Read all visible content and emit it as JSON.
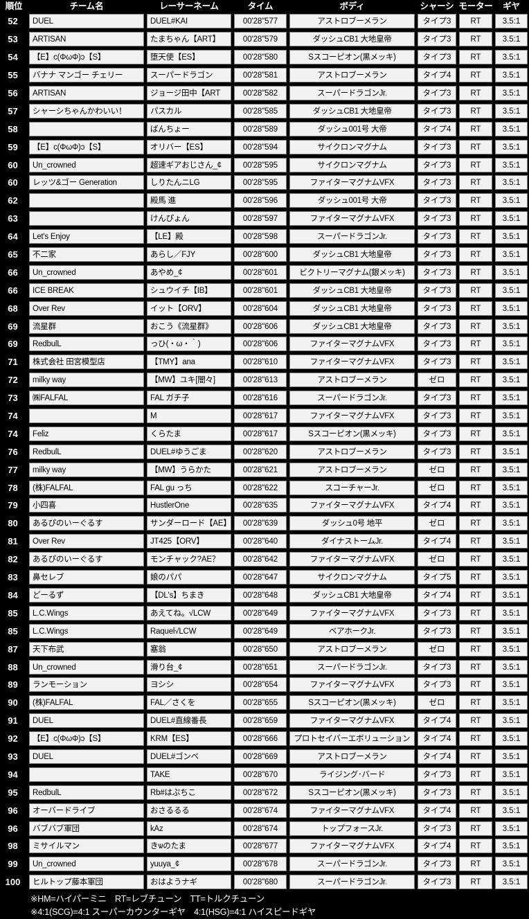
{
  "table": {
    "headers": [
      "順位",
      "チーム名",
      "レーサーネーム",
      "タイム",
      "ボディ",
      "シャーシ",
      "モーター",
      "ギヤ"
    ],
    "rows": [
      {
        "rank": "52",
        "team": "DUEL",
        "racer": "DUEL#KAI",
        "time": "00'28\"577",
        "body": "アストロブーメラン",
        "chassis": "タイプ3",
        "motor": "RT",
        "gear": "3.5:1"
      },
      {
        "rank": "53",
        "team": "ARTISAN",
        "racer": "たまちゃん【ART】",
        "time": "00'28\"579",
        "body": "ダッシュCB1 大地皇帝",
        "chassis": "タイプ3",
        "motor": "RT",
        "gear": "3.5:1"
      },
      {
        "rank": "54",
        "team": "【E】ϲ(ΦωΦ)ɔ【S】",
        "racer": "堕天使【ES】",
        "time": "00'28\"580",
        "body": "Sスコーピオン(黒メッキ)",
        "chassis": "タイプ3",
        "motor": "RT",
        "gear": "3.5:1"
      },
      {
        "rank": "55",
        "team": "バナナ マンゴー チェリー",
        "racer": "スーパードラゴン",
        "time": "00'28\"581",
        "body": "アストロブーメラン",
        "chassis": "タイプ4",
        "motor": "RT",
        "gear": "3.5:1"
      },
      {
        "rank": "56",
        "team": "ARTISAN",
        "racer": "ジョージ田中【ART",
        "time": "00'28\"582",
        "body": "スーパードラゴンJr.",
        "chassis": "タイプ3",
        "motor": "RT",
        "gear": "3.5:1"
      },
      {
        "rank": "57",
        "team": "シャーシちゃんかわいい！",
        "racer": "パスカル",
        "time": "00'28\"585",
        "body": "ダッシュCB1 大地皇帝",
        "chassis": "タイプ3",
        "motor": "RT",
        "gear": "3.5:1"
      },
      {
        "rank": "58",
        "team": "",
        "racer": "ばんちょー",
        "time": "00'28\"589",
        "body": "ダッシュ001号 大帝",
        "chassis": "タイプ4",
        "motor": "RT",
        "gear": "3.5:1"
      },
      {
        "rank": "59",
        "team": "【E】ϲ(ΦωΦ)ɔ【S】",
        "racer": "オリバー【ES】",
        "time": "00'28\"594",
        "body": "サイクロンマグナム",
        "chassis": "タイプ3",
        "motor": "RT",
        "gear": "3.5:1"
      },
      {
        "rank": "60",
        "team": "Un_crowned",
        "racer": "超速ギアおじさん_¢",
        "time": "00'28\"595",
        "body": "サイクロンマグナム",
        "chassis": "タイプ3",
        "motor": "RT",
        "gear": "3.5:1"
      },
      {
        "rank": "60",
        "team": "レッツ&ゴー Generation",
        "racer": "しりたんニLG",
        "time": "00'28\"595",
        "body": "ファイターマグナムVFX",
        "chassis": "タイプ3",
        "motor": "RT",
        "gear": "3.5:1"
      },
      {
        "rank": "62",
        "team": "",
        "racer": "殿馬 進",
        "time": "00'28\"596",
        "body": "ダッシュ001号 大帝",
        "chassis": "タイプ3",
        "motor": "RT",
        "gear": "3.5:1"
      },
      {
        "rank": "63",
        "team": "",
        "racer": "けんぴょん",
        "time": "00'28\"597",
        "body": "ファイターマグナムVFX",
        "chassis": "タイプ3",
        "motor": "RT",
        "gear": "3.5:1"
      },
      {
        "rank": "64",
        "team": "Let's Enjoy",
        "racer": "【LE】殿",
        "time": "00'28\"598",
        "body": "スーパードラゴンJr.",
        "chassis": "タイプ3",
        "motor": "RT",
        "gear": "3.5:1"
      },
      {
        "rank": "65",
        "team": "不二家",
        "racer": "あらし／FJY",
        "time": "00'28\"600",
        "body": "ダッシュCB1 大地皇帝",
        "chassis": "タイプ3",
        "motor": "RT",
        "gear": "3.5:1"
      },
      {
        "rank": "66",
        "team": "Un_crowned",
        "racer": "あやめ_¢",
        "time": "00'28\"601",
        "body": "ビクトリーマグナム(銀メッキ)",
        "chassis": "タイプ3",
        "motor": "RT",
        "gear": "3.5:1"
      },
      {
        "rank": "66",
        "team": "ICE BREAK",
        "racer": "シュウイチ【IB】",
        "time": "00'28\"601",
        "body": "ダッシュCB1 大地皇帝",
        "chassis": "タイプ3",
        "motor": "RT",
        "gear": "3.5:1"
      },
      {
        "rank": "68",
        "team": "Over Rev",
        "racer": "イット【ORV】",
        "time": "00'28\"604",
        "body": "ダッシュCB1 大地皇帝",
        "chassis": "タイプ3",
        "motor": "RT",
        "gear": "3.5:1"
      },
      {
        "rank": "69",
        "team": "流星群",
        "racer": "おこう《流星群》",
        "time": "00'28\"606",
        "body": "ダッシュCB1 大地皇帝",
        "chassis": "タイプ3",
        "motor": "RT",
        "gear": "3.5:1"
      },
      {
        "rank": "69",
        "team": "RedbulL",
        "racer": "っひ(・ω・｀)",
        "time": "00'28\"606",
        "body": "ファイターマグナムVFX",
        "chassis": "タイプ3",
        "motor": "RT",
        "gear": "3.5:1"
      },
      {
        "rank": "71",
        "team": "株式会社 田宮模型店",
        "racer": "【TMY】ana",
        "time": "00'28\"610",
        "body": "ファイターマグナムVFX",
        "chassis": "タイプ3",
        "motor": "RT",
        "gear": "3.5:1"
      },
      {
        "rank": "72",
        "team": "milky way",
        "racer": "【MW】ユキ[闇々]",
        "time": "00'28\"613",
        "body": "アストロブーメラン",
        "chassis": "ゼロ",
        "motor": "RT",
        "gear": "3.5:1"
      },
      {
        "rank": "73",
        "team": "㈱FALFAL",
        "racer": "FAL ガチ子",
        "time": "00'28\"616",
        "body": "スーパードラゴンJr.",
        "chassis": "タイプ3",
        "motor": "RT",
        "gear": "3.5:1"
      },
      {
        "rank": "74",
        "team": "",
        "racer": "M",
        "time": "00'28\"617",
        "body": "ファイターマグナムVFX",
        "chassis": "タイプ3",
        "motor": "RT",
        "gear": "3.5:1"
      },
      {
        "rank": "74",
        "team": "Feliz",
        "racer": "くらたま",
        "time": "00'28\"617",
        "body": "Sスコーピオン(黒メッキ)",
        "chassis": "タイプ3",
        "motor": "RT",
        "gear": "3.5:1"
      },
      {
        "rank": "76",
        "team": "RedbulL",
        "racer": "DUEL#ゆうごま",
        "time": "00'28\"620",
        "body": "アストロブーメラン",
        "chassis": "タイプ3",
        "motor": "RT",
        "gear": "3.5:1"
      },
      {
        "rank": "77",
        "team": "milky way",
        "racer": "【MW】うらかた",
        "time": "00'28\"621",
        "body": "アストロブーメラン",
        "chassis": "ゼロ",
        "motor": "RT",
        "gear": "3.5:1"
      },
      {
        "rank": "78",
        "team": "(株)FALFAL",
        "racer": "FAL gu っち",
        "time": "00'28\"622",
        "body": "スコーチャーJr.",
        "chassis": "ゼロ",
        "motor": "RT",
        "gear": "3.5:1"
      },
      {
        "rank": "79",
        "team": "小四喜",
        "racer": "HustlerOne",
        "time": "00'28\"635",
        "body": "ファイターマグナムVFX",
        "chassis": "タイプ4",
        "motor": "RT",
        "gear": "3.5:1"
      },
      {
        "rank": "80",
        "team": "あるぴのいーぐるす",
        "racer": "サンダーロード【AE】",
        "time": "00'28\"639",
        "body": "ダッシュ0号 地平",
        "chassis": "ゼロ",
        "motor": "RT",
        "gear": "3.5:1"
      },
      {
        "rank": "81",
        "team": "Over Rev",
        "racer": "JT425【ORV】",
        "time": "00'28\"640",
        "body": "ダイナストームJr.",
        "chassis": "タイプ4",
        "motor": "RT",
        "gear": "3.5:1"
      },
      {
        "rank": "82",
        "team": "あるぴのいーぐるす",
        "racer": "モンチャック?AE？",
        "time": "00'28\"642",
        "body": "ファイターマグナムVFX",
        "chassis": "ゼロ",
        "motor": "RT",
        "gear": "3.5:1"
      },
      {
        "rank": "83",
        "team": "鼻セレブ",
        "racer": "娘のパパ",
        "time": "00'28\"647",
        "body": "サイクロンマグナム",
        "chassis": "タイプ5",
        "motor": "RT",
        "gear": "3.5:1"
      },
      {
        "rank": "84",
        "team": "どーるず",
        "racer": "【DL's】ちまき",
        "time": "00'28\"648",
        "body": "ダッシュCB1 大地皇帝",
        "chassis": "タイプ4",
        "motor": "RT",
        "gear": "3.5:1"
      },
      {
        "rank": "85",
        "team": "L.C.Wings",
        "racer": "あえてね。√LCW",
        "time": "00'28\"649",
        "body": "ファイターマグナムVFX",
        "chassis": "タイプ3",
        "motor": "RT",
        "gear": "3.5:1"
      },
      {
        "rank": "85",
        "team": "L.C.Wings",
        "racer": "Raquel√LCW",
        "time": "00'28\"649",
        "body": "ベアホークJr.",
        "chassis": "タイプ3",
        "motor": "RT",
        "gear": "3.5:1"
      },
      {
        "rank": "87",
        "team": "天下布武",
        "racer": "塞翁",
        "time": "00'28\"650",
        "body": "アストロブーメラン",
        "chassis": "ゼロ",
        "motor": "RT",
        "gear": "3.5:1"
      },
      {
        "rank": "88",
        "team": "Un_crowned",
        "racer": "滑り台_¢",
        "time": "00'28\"651",
        "body": "スーパードラゴンJr.",
        "chassis": "タイプ3",
        "motor": "RT",
        "gear": "3.5:1"
      },
      {
        "rank": "89",
        "team": "ランモーション",
        "racer": "ヨシシ",
        "time": "00'28\"654",
        "body": "ファイターマグナムVFX",
        "chassis": "タイプ3",
        "motor": "RT",
        "gear": "3.5:1"
      },
      {
        "rank": "90",
        "team": "(株)FALFAL",
        "racer": "FAL／さくを",
        "time": "00'28\"655",
        "body": "Sスコーピオン(黒メッキ)",
        "chassis": "ゼロ",
        "motor": "RT",
        "gear": "3.5:1"
      },
      {
        "rank": "91",
        "team": "DUEL",
        "racer": "DUEL#直線番長",
        "time": "00'28\"659",
        "body": "ファイターマグナムVFX",
        "chassis": "タイプ4",
        "motor": "RT",
        "gear": "3.5:1"
      },
      {
        "rank": "92",
        "team": "【E】ϲ(ΦωΦ)ɔ【S】",
        "racer": "KRM【ES】",
        "time": "00'28\"666",
        "body": "プロトセイバーエボリューション",
        "chassis": "タイプ4",
        "motor": "RT",
        "gear": "3.5:1"
      },
      {
        "rank": "93",
        "team": "DUEL",
        "racer": "DUEL#ゴンベ",
        "time": "00'28\"669",
        "body": "アストロブーメラン",
        "chassis": "タイプ4",
        "motor": "RT",
        "gear": "3.5:1"
      },
      {
        "rank": "94",
        "team": "",
        "racer": "TAKE",
        "time": "00'28\"670",
        "body": "ライジング･バード",
        "chassis": "タイプ3",
        "motor": "RT",
        "gear": "3.5:1"
      },
      {
        "rank": "95",
        "team": "RedbulL",
        "racer": "Rb#はぷちこ",
        "time": "00'28\"672",
        "body": "Sスコーピオン(黒メッキ)",
        "chassis": "タイプ3",
        "motor": "RT",
        "gear": "3.5:1"
      },
      {
        "rank": "96",
        "team": "オーバードライブ",
        "racer": "おさるるる",
        "time": "00'28\"674",
        "body": "ファイターマグナムVFX",
        "chassis": "タイプ4",
        "motor": "RT",
        "gear": "3.5:1"
      },
      {
        "rank": "96",
        "team": "バブバブ軍団",
        "racer": "kAz",
        "time": "00'28\"674",
        "body": "トップフォースJr.",
        "chassis": "タイプ3",
        "motor": "RT",
        "gear": "3.5:1"
      },
      {
        "rank": "98",
        "team": "ミサイルマン",
        "racer": "きѡのたま",
        "time": "00'28\"677",
        "body": "ファイターマグナムVFX",
        "chassis": "タイプ4",
        "motor": "RT",
        "gear": "3.5:1"
      },
      {
        "rank": "99",
        "team": "Un_crowned",
        "racer": "yuuya_¢",
        "time": "00'28\"678",
        "body": "スーパードラゴンJr.",
        "chassis": "タイプ3",
        "motor": "RT",
        "gear": "3.5:1"
      },
      {
        "rank": "100",
        "team": "ヒルトップ藤本軍団",
        "racer": "おはようナギ",
        "time": "00'28\"680",
        "body": "スーパードラゴンJr.",
        "chassis": "タイプ3",
        "motor": "RT",
        "gear": "3.5:1"
      }
    ]
  },
  "notes": {
    "line1": "※HM=ハイパーミニ　RT=レブチューン　TT=トルクチューン",
    "line2": "※4:1(SCG)=4:1 スーパーカウンターギヤ　4:1(HSG)=4:1 ハイスピードギヤ"
  },
  "colors": {
    "background": "#000000",
    "cell_fill": "#f2f2f2",
    "cell_border": "#7f7f7f",
    "header_text": "#ffffff"
  }
}
